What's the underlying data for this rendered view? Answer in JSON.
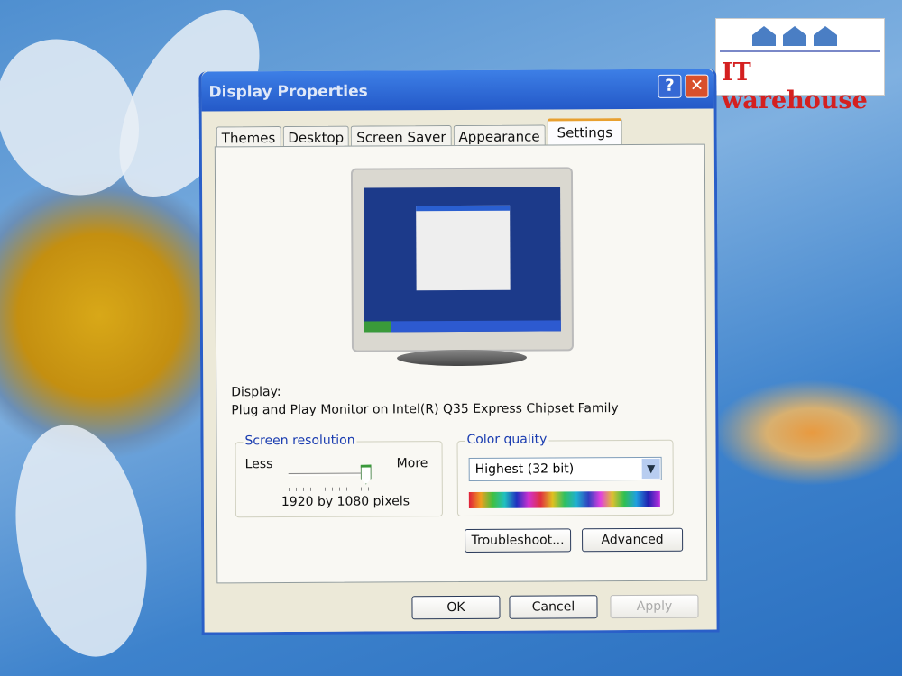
{
  "logo": {
    "text": "IT warehouse"
  },
  "dialog": {
    "title": "Display Properties",
    "help_label": "?",
    "close_label": "✕",
    "tabs": [
      {
        "label": "Themes"
      },
      {
        "label": "Desktop"
      },
      {
        "label": "Screen Saver"
      },
      {
        "label": "Appearance"
      },
      {
        "label": "Settings",
        "active": true
      }
    ],
    "display_label": "Display:",
    "display_device": "Plug and Play Monitor on Intel(R) Q35 Express Chipset Family",
    "resolution": {
      "title": "Screen resolution",
      "less": "Less",
      "more": "More",
      "value": "1920 by 1080 pixels",
      "slider_level": 1.0
    },
    "color_quality": {
      "title": "Color quality",
      "selected": "Highest (32 bit)"
    },
    "buttons": {
      "troubleshoot": "Troubleshoot...",
      "advanced": "Advanced",
      "ok": "OK",
      "cancel": "Cancel",
      "apply": "Apply"
    }
  }
}
